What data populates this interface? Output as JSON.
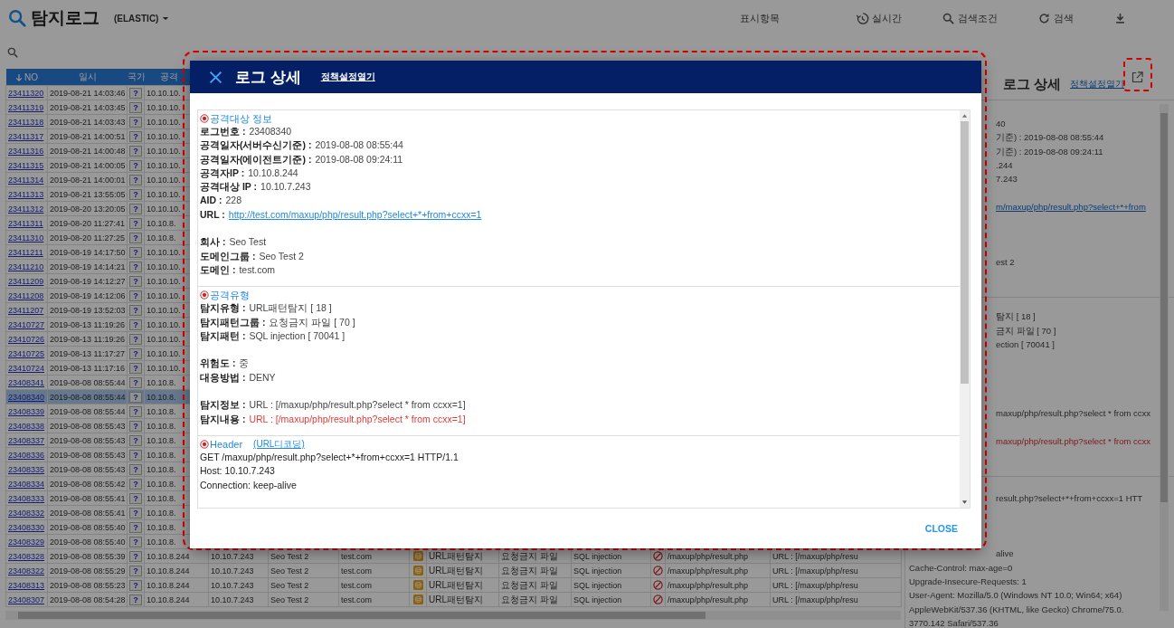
{
  "app": {
    "title": "탐지로그",
    "source": "(ELASTIC)",
    "toolbar": [
      {
        "kind": "text",
        "label": "표시항목"
      },
      {
        "kind": "history",
        "label": "실시간"
      },
      {
        "kind": "search",
        "label": "검색조건"
      },
      {
        "kind": "refresh",
        "label": "검색"
      },
      {
        "kind": "download"
      }
    ]
  },
  "table": {
    "columns": [
      "NO",
      "일시",
      "국가",
      "공격"
    ],
    "rows": [
      {
        "no": "23411320",
        "time": "2019-08-21 14:03:46",
        "country": "?",
        "ip": "10.10.10.",
        "selected": false
      },
      {
        "no": "23411319",
        "time": "2019-08-21 14:03:45",
        "country": "?",
        "ip": "10.10.10.",
        "selected": false
      },
      {
        "no": "23411318",
        "time": "2019-08-21 14:03:43",
        "country": "?",
        "ip": "10.10.10.",
        "selected": false
      },
      {
        "no": "23411317",
        "time": "2019-08-21 14:00:51",
        "country": "?",
        "ip": "10.10.10.",
        "selected": false
      },
      {
        "no": "23411316",
        "time": "2019-08-21 14:00:48",
        "country": "?",
        "ip": "10.10.10.",
        "selected": false
      },
      {
        "no": "23411315",
        "time": "2019-08-21 14:00:05",
        "country": "?",
        "ip": "10.10.10.",
        "selected": false
      },
      {
        "no": "23411314",
        "time": "2019-08-21 14:00:01",
        "country": "?",
        "ip": "10.10.10.",
        "selected": false
      },
      {
        "no": "23411313",
        "time": "2019-08-21 13:55:05",
        "country": "?",
        "ip": "10.10.10.",
        "selected": false
      },
      {
        "no": "23411312",
        "time": "2019-08-20 13:20:05",
        "country": "?",
        "ip": "10.10.10.",
        "selected": false
      },
      {
        "no": "23411311",
        "time": "2019-08-20 11:27:41",
        "country": "?",
        "ip": "10.10.8.",
        "selected": false
      },
      {
        "no": "23411310",
        "time": "2019-08-20 11:27:25",
        "country": "?",
        "ip": "10.10.8.",
        "selected": false
      },
      {
        "no": "23411211",
        "time": "2019-08-19 14:17:50",
        "country": "?",
        "ip": "10.10.10.",
        "selected": false
      },
      {
        "no": "23411210",
        "time": "2019-08-19 14:14:21",
        "country": "?",
        "ip": "10.10.10.",
        "selected": false
      },
      {
        "no": "23411209",
        "time": "2019-08-19 14:12:27",
        "country": "?",
        "ip": "10.10.10.",
        "selected": false
      },
      {
        "no": "23411208",
        "time": "2019-08-19 14:12:06",
        "country": "?",
        "ip": "10.10.10.",
        "selected": false
      },
      {
        "no": "23411207",
        "time": "2019-08-19 13:52:03",
        "country": "?",
        "ip": "10.10.10.",
        "selected": false
      },
      {
        "no": "23410727",
        "time": "2019-08-13 11:19:26",
        "country": "?",
        "ip": "10.10.10.",
        "selected": false
      },
      {
        "no": "23410726",
        "time": "2019-08-13 11:19:26",
        "country": "?",
        "ip": "10.10.10.",
        "selected": false
      },
      {
        "no": "23410725",
        "time": "2019-08-13 11:17:27",
        "country": "?",
        "ip": "10.10.10.",
        "selected": false
      },
      {
        "no": "23410724",
        "time": "2019-08-13 11:17:16",
        "country": "?",
        "ip": "10.10.10.",
        "selected": false
      },
      {
        "no": "23408341",
        "time": "2019-08-08 08:55:44",
        "country": "?",
        "ip": "10.10.8.",
        "selected": false
      },
      {
        "no": "23408340",
        "time": "2019-08-08 08:55:44",
        "country": "?",
        "ip": "10.10.8.",
        "selected": true
      },
      {
        "no": "23408339",
        "time": "2019-08-08 08:55:44",
        "country": "?",
        "ip": "10.10.8.",
        "selected": false
      },
      {
        "no": "23408338",
        "time": "2019-08-08 08:55:43",
        "country": "?",
        "ip": "10.10.8.",
        "selected": false
      },
      {
        "no": "23408337",
        "time": "2019-08-08 08:55:43",
        "country": "?",
        "ip": "10.10.8.",
        "selected": false
      },
      {
        "no": "23408336",
        "time": "2019-08-08 08:55:43",
        "country": "?",
        "ip": "10.10.8.",
        "selected": false
      },
      {
        "no": "23408335",
        "time": "2019-08-08 08:55:43",
        "country": "?",
        "ip": "10.10.8.",
        "selected": false
      },
      {
        "no": "23408334",
        "time": "2019-08-08 08:55:42",
        "country": "?",
        "ip": "10.10.8.",
        "selected": false
      },
      {
        "no": "23408333",
        "time": "2019-08-08 08:55:41",
        "country": "?",
        "ip": "10.10.8.",
        "selected": false
      },
      {
        "no": "23408332",
        "time": "2019-08-08 08:55:41",
        "country": "?",
        "ip": "10.10.8.",
        "selected": false
      },
      {
        "no": "23408330",
        "time": "2019-08-08 08:55:40",
        "country": "?",
        "ip": "10.10.8.",
        "selected": false
      },
      {
        "no": "23408329",
        "time": "2019-08-08 08:55:40",
        "country": "?",
        "ip": "10.10.8.",
        "selected": false
      },
      {
        "no": "23408328",
        "time": "2019-08-08 08:55:39",
        "country": "?",
        "ip": "10.10.8.244",
        "selected": false,
        "detail": {
          "target_ip": "10.10.7.243",
          "company": "Seo Test 2",
          "domain": "test.com",
          "type": "URL패턴탐지",
          "group": "요청금지 파일",
          "pattern": "SQL injection",
          "path": "/maxup/php/result.php",
          "info": "URL : [/maxup/php/resu"
        }
      },
      {
        "no": "23408322",
        "time": "2019-08-08 08:55:29",
        "country": "?",
        "ip": "10.10.8.244",
        "selected": false,
        "detail": {
          "target_ip": "10.10.7.243",
          "company": "Seo Test 2",
          "domain": "test.com",
          "type": "URL패턴탐지",
          "group": "요청금지 파일",
          "pattern": "SQL injection",
          "path": "/maxup/php/result.php",
          "info": "URL : [/maxup/php/resu"
        }
      },
      {
        "no": "23408313",
        "time": "2019-08-08 08:55:23",
        "country": "?",
        "ip": "10.10.8.244",
        "selected": false,
        "detail": {
          "target_ip": "10.10.7.243",
          "company": "Seo Test 2",
          "domain": "test.com",
          "type": "URL패턴탐지",
          "group": "요청금지 파일",
          "pattern": "SQL injection",
          "path": "/maxup/php/result.php",
          "info": "URL : [/maxup/php/resu"
        }
      },
      {
        "no": "23408307",
        "time": "2019-08-08 08:54:28",
        "country": "?",
        "ip": "10.10.8.244",
        "selected": false,
        "detail": {
          "target_ip": "10.10.7.243",
          "company": "Seo Test 2",
          "domain": "test.com",
          "type": "URL패턴탐지",
          "group": "요청금지 파일",
          "pattern": "SQL injection",
          "path": "/maxup/php/result.php",
          "info": "URL : [/maxup/php/resu"
        }
      }
    ]
  },
  "side_panel": {
    "title": "로그 상세",
    "link": "정책설정열기",
    "sections": [
      {
        "paragraphs": [
          [
            {
              "text": "40",
              "cut": true
            },
            {
              "text": "기준) : 2019-08-08 08:55:44",
              "cut": true
            },
            {
              "text": "기준) : 2019-08-08 09:24:11",
              "cut": true
            },
            {
              "text": ".244",
              "cut": true
            },
            {
              "text": "7.243",
              "cut": true
            }
          ],
          [
            {
              "text": "m/maxup/php/result.php?select+*+from",
              "cut": true,
              "kind": "link"
            }
          ],
          [
            {
              "text": "est 2",
              "cut": true
            }
          ]
        ]
      },
      {
        "paragraphs": [
          [
            {
              "text": "탐지 [ 18 ]",
              "cut": true
            },
            {
              "text": "금지 파일 [ 70 ]",
              "cut": true
            },
            {
              "text": "ection [ 70041 ]",
              "cut": true
            }
          ],
          [
            {
              "text": "maxup/php/result.php?select * from ccxx",
              "cut": true
            }
          ],
          [
            {
              "text": "maxup/php/result.php?select * from ccxx",
              "cut": true,
              "kind": "alert"
            }
          ]
        ]
      },
      {
        "paragraphs": [
          [
            {
              "text": "result.php?select+*+from+ccxx=1 HTT",
              "cut": true
            }
          ],
          [
            {
              "text": "alive",
              "cut": true
            },
            {
              "text": "Cache-Control: max-age=0",
              "cut": false
            },
            {
              "text": "Upgrade-Insecure-Requests: 1",
              "cut": false
            },
            {
              "text": "User-Agent: Mozilla/5.0 (Windows NT 10.0; Win64; x64)",
              "cut": false
            },
            {
              "text": " AppleWebKit/537.36 (KHTML, like Gecko) Chrome/75.0.",
              "cut": false
            },
            {
              "text": "3770.142 Safari/537.36",
              "cut": false
            }
          ]
        ]
      }
    ]
  },
  "modal": {
    "title": "로그 상세",
    "link": "정책설정열기",
    "close": "CLOSE",
    "sections": [
      {
        "title": "공격대상 정보",
        "paragraphs": [
          [
            {
              "label": "로그번호 :",
              "value": "23408340"
            },
            {
              "label": "공격일자(서버수신기준) :",
              "value": "2019-08-08 08:55:44"
            },
            {
              "label": "공격일자(에이전트기준) :",
              "value": "2019-08-08 09:24:11"
            },
            {
              "label": "공격자IP :",
              "value": "10.10.8.244"
            },
            {
              "label": "공격대상 IP :",
              "value": "10.10.7.243"
            },
            {
              "label": "AID :",
              "value": "228"
            },
            {
              "label": "URL :",
              "value": "http://test.com/maxup/php/result.php?select+*+from+ccxx=1",
              "kind": "link"
            }
          ],
          [
            {
              "label": "회사 :",
              "value": "Seo Test"
            },
            {
              "label": "도메인그룹 :",
              "value": "Seo Test 2"
            },
            {
              "label": "도메인 :",
              "value": "test.com"
            }
          ]
        ]
      },
      {
        "title": "공격유형",
        "paragraphs": [
          [
            {
              "label": "탐지유형 :",
              "value": "URL패턴탐지 [ 18 ]"
            },
            {
              "label": "탐지패턴그룹 :",
              "value": "요청금지 파일 [ 70 ]"
            },
            {
              "label": "탐지패턴 :",
              "value": "SQL injection [ 70041 ]"
            }
          ],
          [
            {
              "label": "위험도 :",
              "value": "중"
            },
            {
              "label": "대응방법 :",
              "value": "DENY"
            }
          ],
          [
            {
              "label": "탐지정보 :",
              "value": "URL : [/maxup/php/result.php?select * from ccxx=1]"
            },
            {
              "label": "탐지내용 :",
              "value": "URL : [/maxup/php/result.php?select * from ccxx=1]",
              "kind": "alert"
            }
          ]
        ]
      },
      {
        "title": "Header",
        "link": "(URL디코딩)",
        "paragraphs": [
          [
            {
              "value": "GET /maxup/php/result.php?select+*+from+ccxx=1 HTTP/1.1"
            },
            {
              "value": "Host: 10.10.7.243"
            },
            {
              "value": "Connection: keep-alive"
            }
          ]
        ]
      }
    ]
  }
}
